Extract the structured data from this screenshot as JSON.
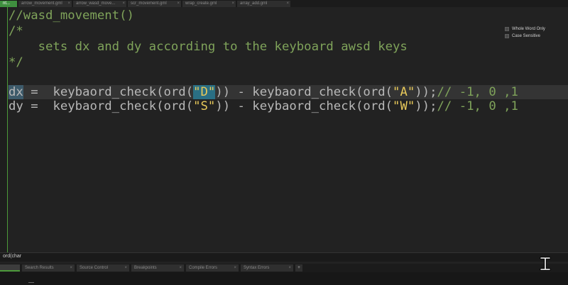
{
  "tabs": [
    {
      "label": "nt...",
      "active": true
    },
    {
      "label": "arrow_movement.gml"
    },
    {
      "label": "arrow_wasd_move..."
    },
    {
      "label": "scr_movement.gml"
    },
    {
      "label": "wrap_create.gml"
    },
    {
      "label": "array_add.gml"
    }
  ],
  "editor": {
    "lines": {
      "l1": "//wasd_movement()",
      "l2": "/*",
      "l3": "    sets dx and dy according to the keyboard awsd keys",
      "l4": "*/",
      "dx_var": "dx",
      "dx_eq": " =  ",
      "dx_f1": "keybaord_check(ord(",
      "dx_s1": "\"D\"",
      "dx_mid": ")) - keybaord_check(ord(",
      "dx_s2": "\"A\"",
      "dx_end": "));",
      "dx_comment": "// -1, 0 ,1",
      "dy_var": "dy",
      "dy_eq": " =  ",
      "dy_f1": "keybaord_check(ord(",
      "dy_s1": "\"S\"",
      "dy_mid": ")) - keybaord_check(ord(",
      "dy_s2": "\"W\"",
      "dy_end": "));",
      "dy_comment": "// -1, 0 ,1"
    }
  },
  "search_options": {
    "whole_word": "Whole Word Only",
    "case_sensitive": "Case Sensitive"
  },
  "status_bar": {
    "text": "ord(char"
  },
  "panel_tabs": [
    {
      "label": ""
    },
    {
      "label": "Search Results"
    },
    {
      "label": "Source Control"
    },
    {
      "label": "Breakpoints"
    },
    {
      "label": "Compile Errors"
    },
    {
      "label": "Syntax Errors"
    }
  ],
  "panel_add": "+",
  "colors": {
    "background": "#222222",
    "accent": "#4c9a3a",
    "comment": "#7fa35a",
    "string": "#e8c95a"
  }
}
